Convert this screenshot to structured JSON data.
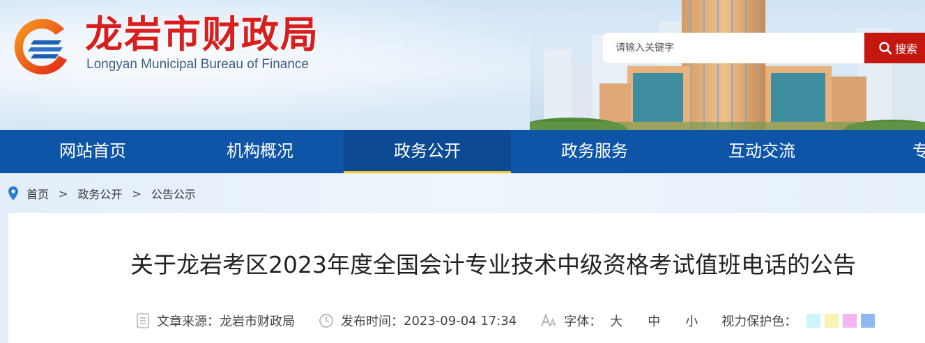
{
  "header": {
    "title": "龙岩市财政局",
    "subtitle": "Longyan Municipal Bureau of Finance",
    "search_placeholder": "请输入关键字",
    "search_button": "搜索"
  },
  "nav": {
    "items": [
      {
        "label": "网站首页",
        "active": false
      },
      {
        "label": "机构概况",
        "active": false
      },
      {
        "label": "政务公开",
        "active": true
      },
      {
        "label": "政务服务",
        "active": false
      },
      {
        "label": "互动交流",
        "active": false
      },
      {
        "label": "专题",
        "active": false
      }
    ],
    "active_color": "#0c4a93",
    "indicator_color": "#f2c92a"
  },
  "breadcrumb": {
    "items": [
      "首页",
      "政务公开",
      "公告公示"
    ],
    "separator": ">"
  },
  "article": {
    "title": "关于龙岩考区2023年度全国会计专业技术中级资格考试值班电话的公告",
    "source_label": "文章来源：",
    "source_value": "龙岩市财政局",
    "time_label": "发布时间：",
    "time_value": "2023-09-04 17:34",
    "font_label": "字体：",
    "font_sizes": [
      "大",
      "中",
      "小"
    ],
    "eye_label": "视力保护色：",
    "eye_colors": [
      "#ccf5fb",
      "#f7f3b2",
      "#f5b4f5",
      "#8fb9f5"
    ]
  },
  "icons": {
    "logo": "finance-bureau-logo",
    "search": "search-icon",
    "location": "location-pin-icon",
    "document": "document-icon",
    "clock": "clock-icon",
    "font": "font-size-icon"
  },
  "colors": {
    "nav_bg": "#0f55a7",
    "brand_red": "#d81e1e",
    "search_btn": "#c4170f"
  }
}
